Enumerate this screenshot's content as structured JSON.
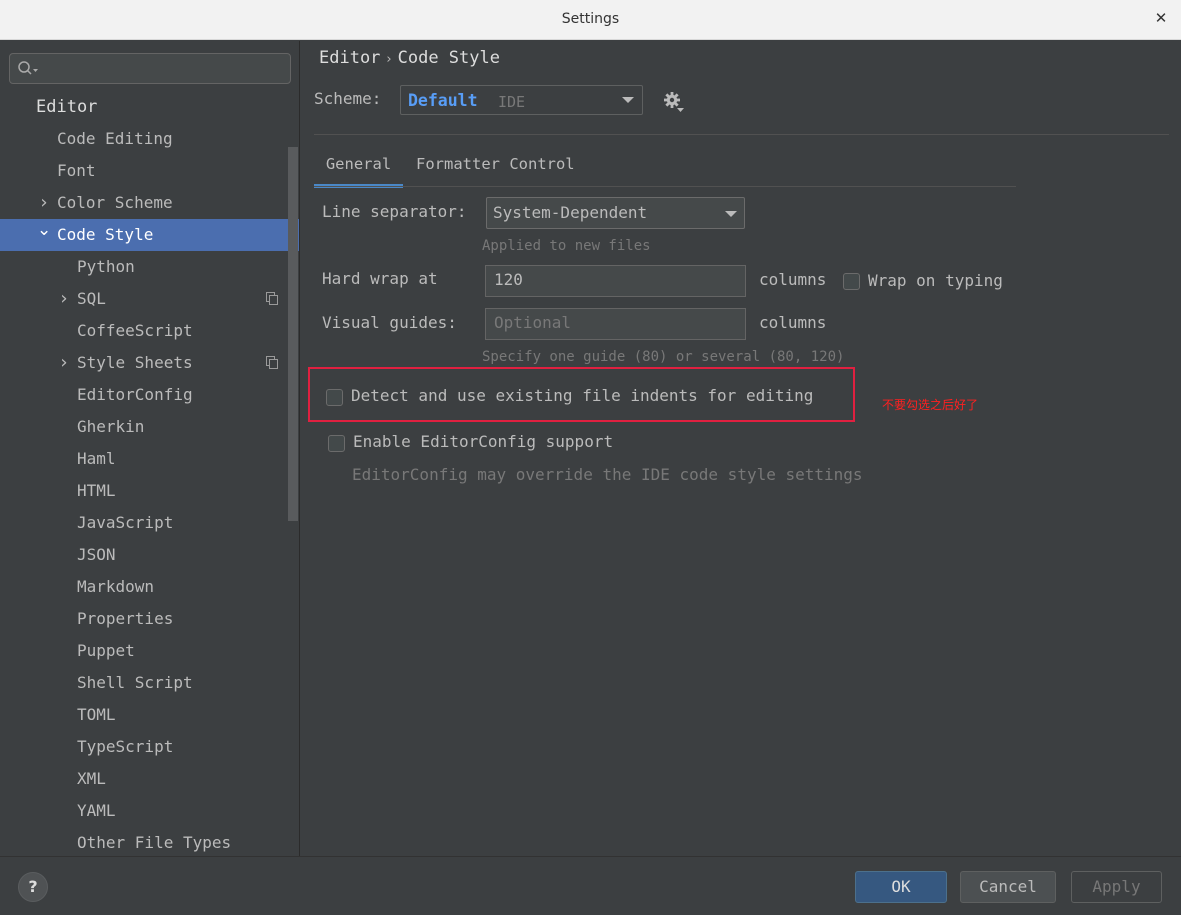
{
  "window": {
    "title": "Settings"
  },
  "sidebar": {
    "search_placeholder": "",
    "items": [
      {
        "label": "Editor",
        "level": 0,
        "expandable": false
      },
      {
        "label": "Code Editing",
        "level": 1,
        "expandable": false
      },
      {
        "label": "Font",
        "level": 1,
        "expandable": false
      },
      {
        "label": "Color Scheme",
        "level": 1,
        "expandable": true,
        "expanded": false
      },
      {
        "label": "Code Style",
        "level": 1,
        "expandable": true,
        "expanded": true,
        "selected": true
      },
      {
        "label": "Python",
        "level": 2
      },
      {
        "label": "SQL",
        "level": 2,
        "expandable": true,
        "copy_icon": true
      },
      {
        "label": "CoffeeScript",
        "level": 2
      },
      {
        "label": "Style Sheets",
        "level": 2,
        "expandable": true,
        "copy_icon": true
      },
      {
        "label": "EditorConfig",
        "level": 2
      },
      {
        "label": "Gherkin",
        "level": 2
      },
      {
        "label": "Haml",
        "level": 2
      },
      {
        "label": "HTML",
        "level": 2
      },
      {
        "label": "JavaScript",
        "level": 2
      },
      {
        "label": "JSON",
        "level": 2
      },
      {
        "label": "Markdown",
        "level": 2
      },
      {
        "label": "Properties",
        "level": 2
      },
      {
        "label": "Puppet",
        "level": 2
      },
      {
        "label": "Shell Script",
        "level": 2
      },
      {
        "label": "TOML",
        "level": 2
      },
      {
        "label": "TypeScript",
        "level": 2
      },
      {
        "label": "XML",
        "level": 2
      },
      {
        "label": "YAML",
        "level": 2
      },
      {
        "label": "Other File Types",
        "level": 2
      }
    ]
  },
  "breadcrumb": {
    "parent": "Editor",
    "separator": "›",
    "current": "Code Style"
  },
  "scheme": {
    "label": "Scheme:",
    "name": "Default",
    "type": "IDE"
  },
  "tabs": [
    {
      "label": "General",
      "active": true
    },
    {
      "label": "Formatter Control",
      "active": false
    }
  ],
  "general": {
    "line_separator_label": "Line separator:",
    "line_separator_value": "System-Dependent",
    "line_separator_hint": "Applied to new files",
    "hard_wrap_label": "Hard wrap at",
    "hard_wrap_value": "120",
    "columns_label": "columns",
    "wrap_on_typing_label": "Wrap on typing",
    "visual_guides_label": "Visual guides:",
    "visual_guides_placeholder": "Optional",
    "visual_guides_columns": "columns",
    "visual_guides_hint": "Specify one guide (80) or several (80, 120)",
    "detect_indents_label": "Detect and use existing file indents for editing",
    "editorconfig_label": "Enable EditorConfig support",
    "editorconfig_hint": "EditorConfig may override the IDE code style settings"
  },
  "annotation": {
    "text": "不要勾选之后好了",
    "color": "#ff2020"
  },
  "buttons": {
    "help": "?",
    "ok": "OK",
    "cancel": "Cancel",
    "apply": "Apply"
  },
  "colors": {
    "accent": "#4b6eaf",
    "link": "#589df6",
    "highlight": "#e02040"
  }
}
